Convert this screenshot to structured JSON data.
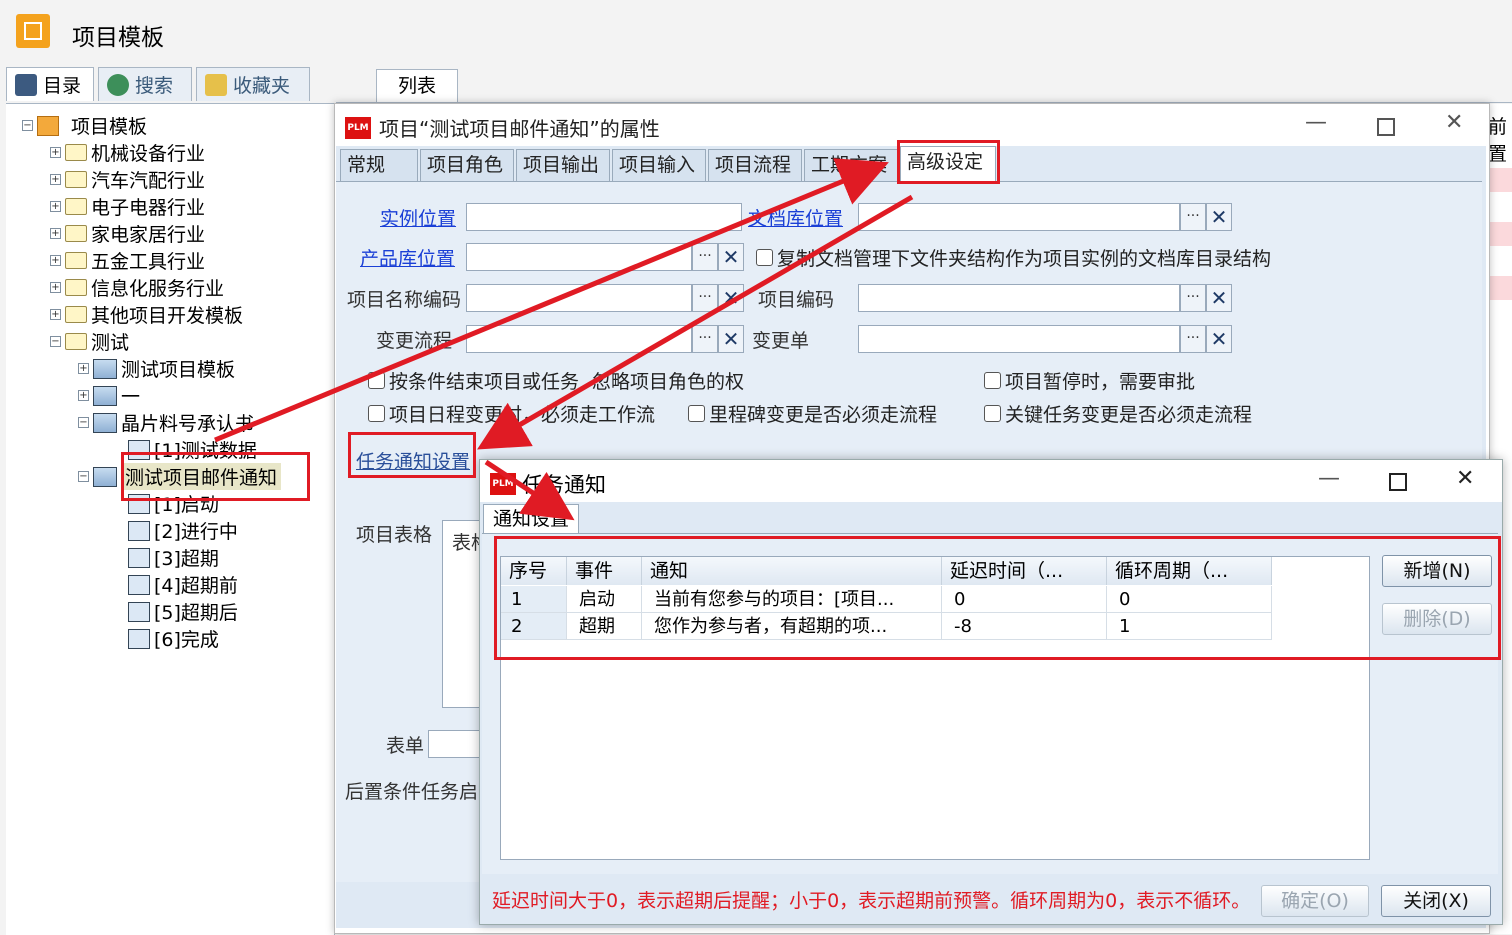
{
  "app": {
    "title": "项目模板"
  },
  "left_tabs": [
    {
      "label": "目录",
      "icon": "computer-icon"
    },
    {
      "label": "搜索",
      "icon": "search-globe-icon"
    },
    {
      "label": "收藏夹",
      "icon": "favorites-icon"
    }
  ],
  "right_tab": {
    "label": "列表"
  },
  "right_edge_text": "前置",
  "tree": {
    "root": "项目模板",
    "industries": [
      "机械设备行业",
      "汽车汽配行业",
      "电子电器行业",
      "家电家居行业",
      "五金工具行业",
      "信息化服务行业",
      "其他项目开发模板",
      "测试"
    ],
    "test_children": [
      "测试项目模板",
      "一",
      "晶片料号承认书"
    ],
    "chip_children": [
      "[1]测试数据"
    ],
    "selected": "测试项目邮件通知",
    "selected_children": [
      "[1]启动",
      "[2]进行中",
      "[3]超期",
      "[4]超期前",
      "[5]超期后",
      "[6]完成"
    ]
  },
  "prop_dialog": {
    "title": "项目“测试项目邮件通知”的属性",
    "tabs": [
      "常规",
      "项目角色",
      "项目输出",
      "项目输入",
      "项目流程",
      "工期方案",
      "高级设定"
    ],
    "active_tab": "高级设定",
    "fields": {
      "instance_location": "实例位置",
      "doclib_location": "文档库位置",
      "product_location": "产品库位置",
      "copy_structure": "复制文档管理下文件夹结构作为项目实例的文档库目录结构",
      "project_name_code": "项目名称编码",
      "project_code": "项目编码",
      "change_flow": "变更流程",
      "change_order": "变更单"
    },
    "checkboxes": [
      "按条件结束项目或任务",
      "忽略项目角色的权",
      "项目暂停时，需要审批",
      "项目日程变更时，必须走工作流",
      "里程碑变更是否必须走流程",
      "关键任务变更是否必须走流程"
    ],
    "task_notify_link": "任务通知设置",
    "project_form_label": "项目表格",
    "table_col": "表格",
    "form_label": "表单",
    "post_cond_label": "后置条件任务启"
  },
  "task_dialog": {
    "title": "任务通知",
    "tab": "通知设置",
    "columns": [
      "序号",
      "事件",
      "通知",
      "延迟时间（...",
      "循环周期（..."
    ],
    "rows": [
      [
        "1",
        "启动",
        "当前有您参与的项目：[项目...",
        "0",
        "0"
      ],
      [
        "2",
        "超期",
        "您作为参与者，有超期的项...",
        "-8",
        "1"
      ]
    ],
    "buttons": {
      "add": "新增(N)",
      "delete": "删除(D)",
      "ok": "确定(O)",
      "close": "关闭(X)"
    },
    "note": "延迟时间大于0，表示超期后提醒；小于0，表示超期前预警。循环周期为0，表示不循环。"
  },
  "colors": {
    "annotation_red": "#e01b24",
    "link_blue": "#1a3fd6",
    "app_orange": "#f4a21d"
  }
}
